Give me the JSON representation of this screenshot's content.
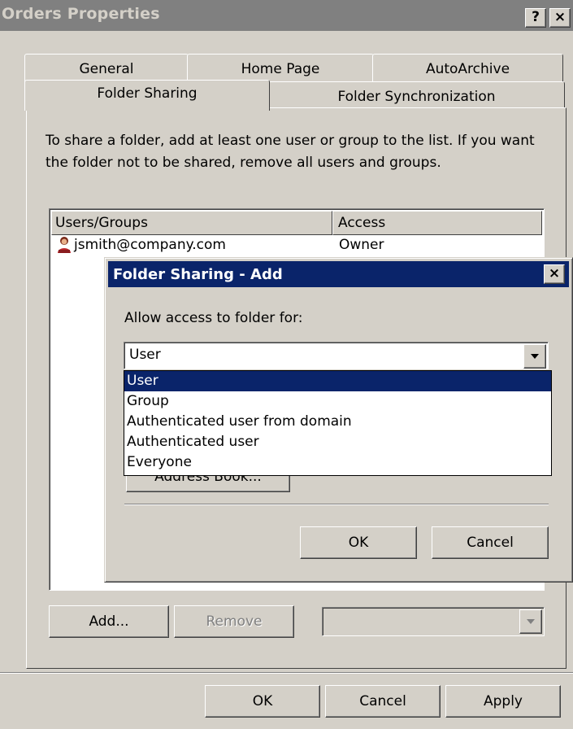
{
  "window": {
    "title": "Orders Properties",
    "help_label": "?",
    "close_label": "×"
  },
  "tabs": {
    "row1": [
      "General",
      "Home Page",
      "AutoArchive"
    ],
    "row2": [
      "Folder Sharing",
      "Folder Synchronization"
    ],
    "active": "Folder Sharing"
  },
  "folder_sharing": {
    "intro_text": "To share a folder, add at least one user or group to the list. If you want the folder not to be shared, remove all users and groups.",
    "columns": [
      "Users/Groups",
      "Access"
    ],
    "rows": [
      {
        "user": "jsmith@company.com",
        "access": "Owner",
        "icon": "user-icon"
      }
    ],
    "add_label": "Add...",
    "remove_label": "Remove",
    "access_select_value": ""
  },
  "add_dialog": {
    "title": "Folder Sharing - Add",
    "close_label": "×",
    "prompt": "Allow access to folder for:",
    "selected_value": "User",
    "options": [
      "User",
      "Group",
      "Authenticated user from domain",
      "Authenticated user",
      "Everyone"
    ],
    "address_book_label": "Address Book...",
    "ok_label": "OK",
    "cancel_label": "Cancel"
  },
  "footer": {
    "ok_label": "OK",
    "cancel_label": "Cancel",
    "apply_label": "Apply"
  },
  "colors": {
    "face": "#d4d0c8",
    "title_active": "#0a246a",
    "title_inactive": "#808080",
    "selection": "#0a246a"
  }
}
